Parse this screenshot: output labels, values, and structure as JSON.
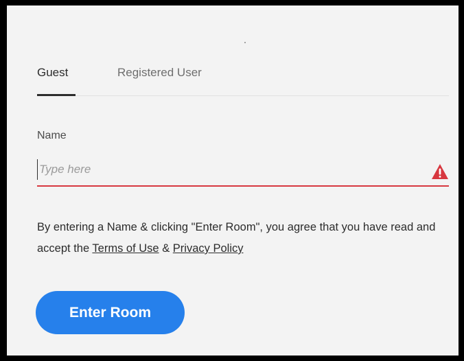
{
  "tabs": [
    {
      "label": "Guest",
      "selected": true
    },
    {
      "label": "Registered User",
      "selected": false
    }
  ],
  "name_field": {
    "label": "Name",
    "placeholder": "Type here",
    "value": "",
    "status_icon": "alert-triangle-icon"
  },
  "terms": {
    "prefix": "By entering a Name & clicking \"Enter Room\", you agree that you have read and accept the ",
    "terms_link": "Terms of Use",
    "joiner": " & ",
    "privacy_link": "Privacy Policy"
  },
  "enter_button": {
    "label": "Enter Room"
  },
  "colors": {
    "accent": "#2680eb",
    "error": "#d7373f",
    "background": "#f3f3f3",
    "frame": "#000000"
  }
}
